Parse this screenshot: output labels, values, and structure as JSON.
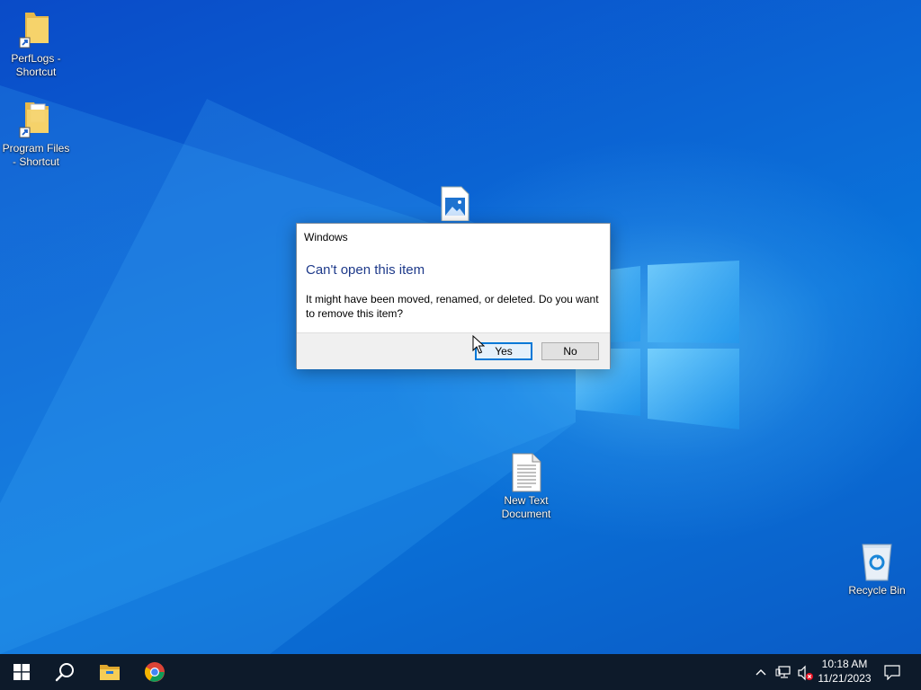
{
  "desktop": {
    "icons": [
      {
        "label": "PerfLogs - Shortcut"
      },
      {
        "label": "Program Files - Shortcut"
      },
      {
        "label": ""
      },
      {
        "label": "New Text Document"
      },
      {
        "label": "Recycle Bin"
      }
    ]
  },
  "dialog": {
    "title": "Windows",
    "heading": "Can't open this item",
    "message": "It might have been moved, renamed, or deleted. Do you want to remove this item?",
    "yes_label": "Yes",
    "no_label": "No"
  },
  "taskbar": {
    "start_icon": "windows-start-icon",
    "search_icon": "search-icon",
    "pinned": [
      {
        "icon": "file-explorer-icon"
      },
      {
        "icon": "chrome-icon"
      }
    ],
    "tray": {
      "icons": [
        "chevron-up-icon",
        "network-icon",
        "volume-muted-icon",
        "notifications-icon"
      ]
    },
    "clock": {
      "time": "10:18 AM",
      "date": "11/21/2023"
    }
  },
  "colors": {
    "accent": "#0078d7",
    "heading_text": "#1e3a8a",
    "taskbar_bg": "#0d1a2a"
  }
}
